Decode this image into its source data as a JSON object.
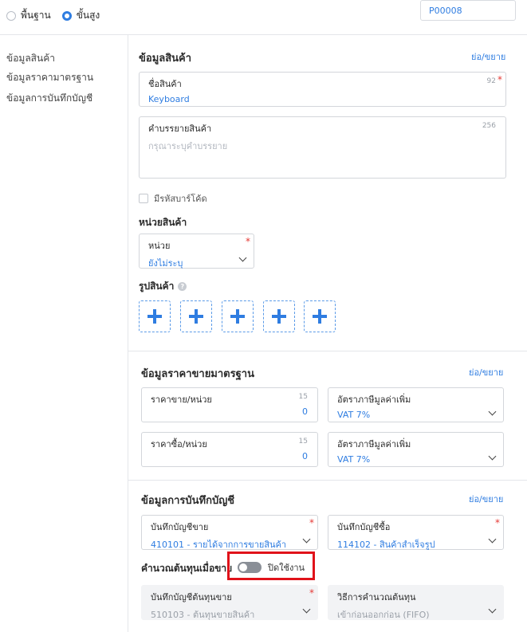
{
  "top": {
    "radio_basic": "พื้นฐาน",
    "radio_advanced": "ขั้นสูง",
    "product_code": "P00008"
  },
  "sidebar": {
    "items": [
      "ข้อมูลสินค้า",
      "ข้อมูลราคามาตรฐาน",
      "ข้อมูลการบันทึกบัญชี"
    ]
  },
  "product_info": {
    "title": "ข้อมูลสินค้า",
    "collapse": "ย่อ/ขยาย",
    "name_label": "ชื่อสินค้า",
    "name_value": "Keyboard",
    "name_counter": "92",
    "desc_label": "คำบรรยายสินค้า",
    "desc_placeholder": "กรุณาระบุคำบรรยาย",
    "desc_counter": "256",
    "barcode_label": "มีรหัสบาร์โค้ด",
    "unit_title": "หน่วยสินค้า",
    "unit_label": "หน่วย",
    "unit_value": "ยังไม่ระบุ",
    "image_title": "รูปสินค้า",
    "help_glyph": "?"
  },
  "price_info": {
    "title": "ข้อมูลราคาขายมาตรฐาน",
    "collapse": "ย่อ/ขยาย",
    "sell_label": "ราคาขาย/หน่วย",
    "sell_counter": "15",
    "sell_value": "0",
    "vat_label_1": "อัตราภาษีมูลค่าเพิ่ม",
    "vat_value_1": "VAT 7%",
    "buy_label": "ราคาซื้อ/หน่วย",
    "buy_counter": "15",
    "buy_value": "0",
    "vat_label_2": "อัตราภาษีมูลค่าเพิ่ม",
    "vat_value_2": "VAT 7%"
  },
  "account_info": {
    "title": "ข้อมูลการบันทึกบัญชี",
    "collapse": "ย่อ/ขยาย",
    "sales_acc_label": "บันทึกบัญชีขาย",
    "sales_acc_value": "410101 - รายได้จากการขายสินค้า",
    "purchase_acc_label": "บันทึกบัญชีซื้อ",
    "purchase_acc_value": "114102 - สินค้าสำเร็จรูป",
    "cost_calc_label": "คำนวณต้นทุนเมื่อขาย",
    "cost_switch_state": "ปิดใช้งาน",
    "cost_acc_label": "บันทึกบัญชีต้นทุนขาย",
    "cost_acc_value": "510103 - ต้นทุนขายสินค้า",
    "cost_method_label": "วิธีการคำนวณต้นทุน",
    "cost_method_value": "เข้าก่อนออกก่อน (FIFO)"
  },
  "colors": {
    "accent": "#2f7de1",
    "required": "#e53935",
    "highlight": "#e0121a"
  }
}
